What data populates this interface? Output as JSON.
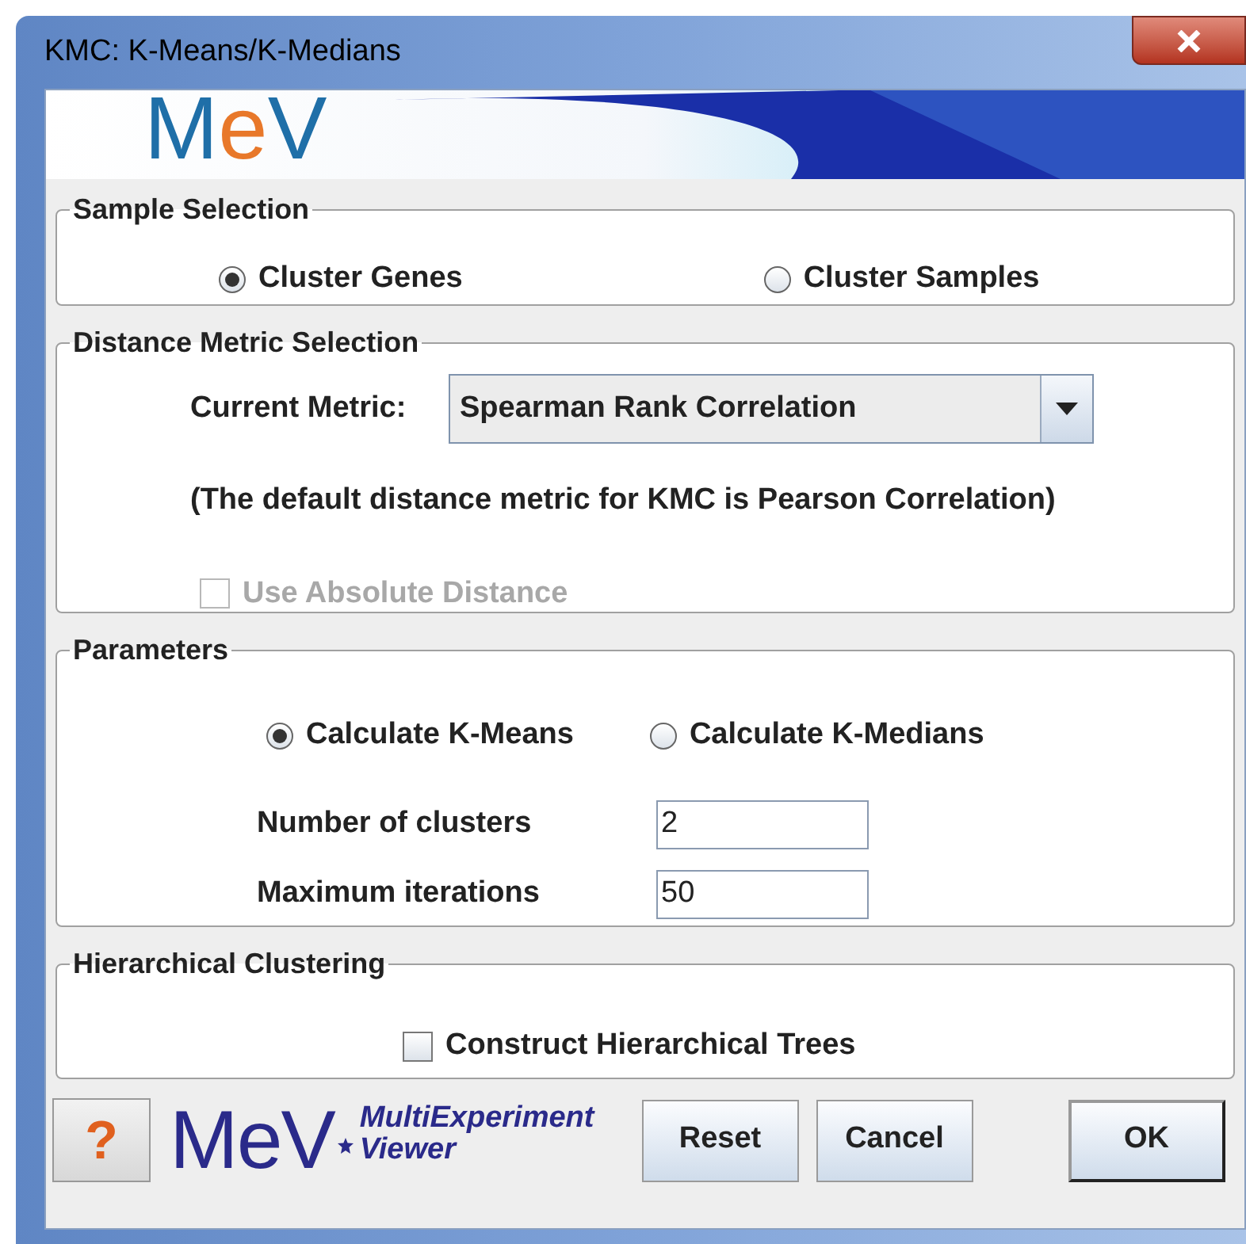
{
  "window": {
    "title": "KMC: K-Means/K-Medians"
  },
  "banner": {
    "logo": "MeV"
  },
  "sample_selection": {
    "title": "Sample Selection",
    "options": [
      {
        "label": "Cluster Genes",
        "selected": true
      },
      {
        "label": "Cluster Samples",
        "selected": false
      }
    ]
  },
  "distance_metric": {
    "title": "Distance Metric Selection",
    "label": "Current Metric:",
    "value": "Spearman Rank Correlation",
    "note": "(The default distance metric for KMC is Pearson Correlation)",
    "absolute": {
      "label": "Use Absolute Distance",
      "checked": false,
      "disabled": true
    }
  },
  "parameters": {
    "title": "Parameters",
    "methods": [
      {
        "label": "Calculate K-Means",
        "selected": true
      },
      {
        "label": "Calculate K-Medians",
        "selected": false
      }
    ],
    "fields": [
      {
        "label": "Number of clusters",
        "value": "2"
      },
      {
        "label": "Maximum iterations",
        "value": "50"
      }
    ]
  },
  "hierarchical": {
    "title": "Hierarchical Clustering",
    "trees": {
      "label": "Construct Hierarchical Trees",
      "checked": false,
      "disabled": false
    }
  },
  "footer": {
    "help": "?",
    "logo": "MeV",
    "tagline": [
      "MultiExperiment",
      "Viewer"
    ],
    "buttons": [
      {
        "label": "Reset",
        "default": false
      },
      {
        "label": "Cancel",
        "default": false
      },
      {
        "label": "OK",
        "default": true
      }
    ]
  }
}
